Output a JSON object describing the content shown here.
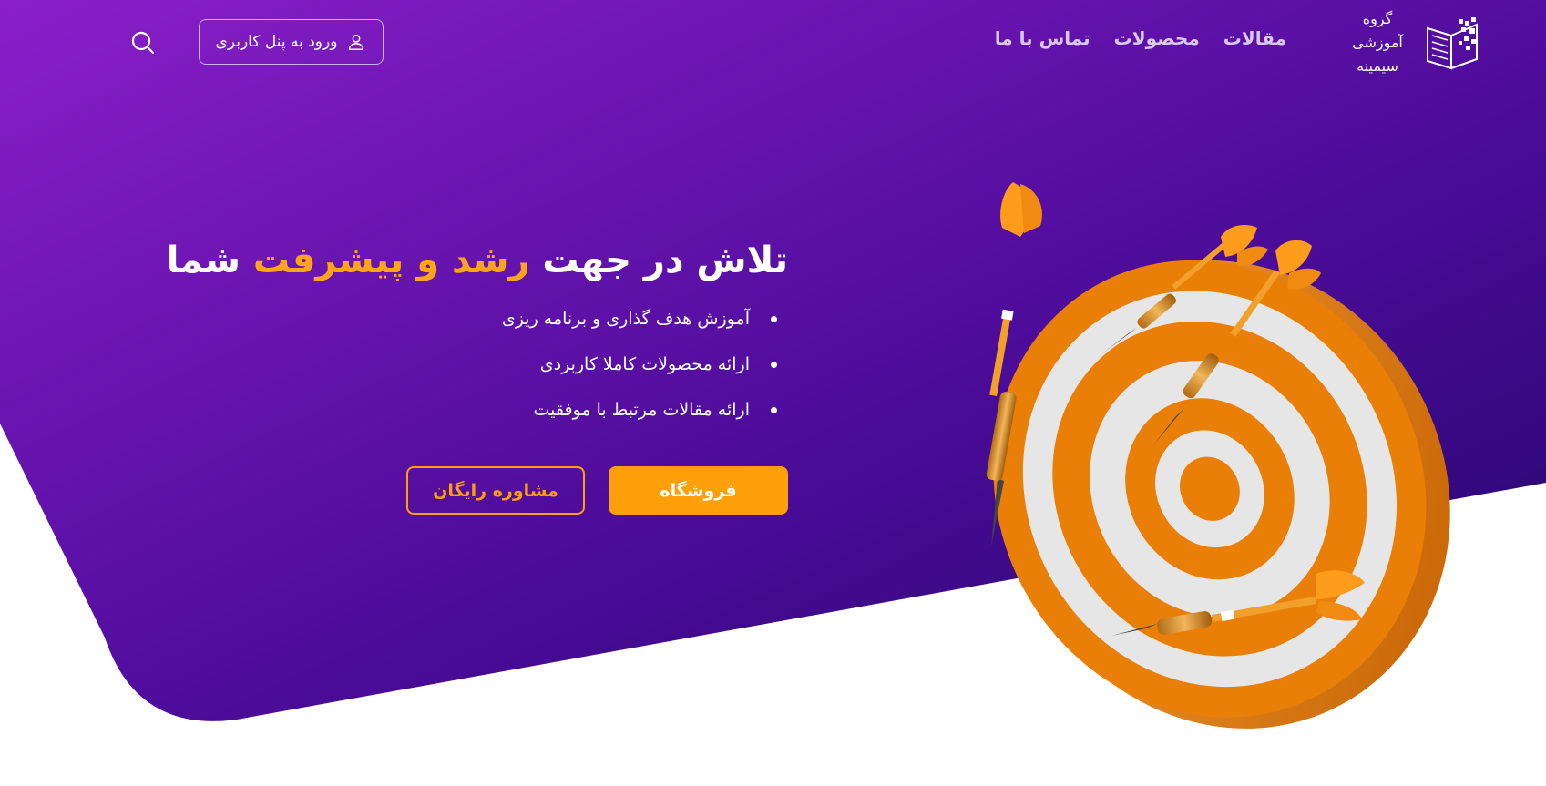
{
  "header": {
    "logo": {
      "line1": "گروه آموزشی",
      "line2": "سیمینه",
      "icon": "book-pixel-logo-icon"
    },
    "nav": [
      {
        "label": "مقالات"
      },
      {
        "label": "محصولات"
      },
      {
        "label": "تماس با ما"
      }
    ],
    "login_label": "ورود به پنل کاربری",
    "login_icon": "user-icon",
    "search_icon": "search-icon"
  },
  "hero": {
    "title_part1": "تلاش در جهت ",
    "title_accent": "رشد و پیشرفت",
    "title_part2": " شما",
    "bullets": [
      "آموزش هدف گذاری و برنامه ریزی",
      "ارائه محصولات کاملا کاربردی",
      "ارائه مقالات مرتبط با موفقیت"
    ],
    "shop_label": "فروشگاه",
    "consult_label": "مشاوره رایگان",
    "illustration": "dartboard-with-darts-illustration"
  },
  "colors": {
    "purple_light": "#8a1fc9",
    "purple_dark": "#2a0870",
    "accent_orange": "#ff9f0a",
    "board_orange": "#ea7f08",
    "board_white": "#e6e6e6"
  }
}
